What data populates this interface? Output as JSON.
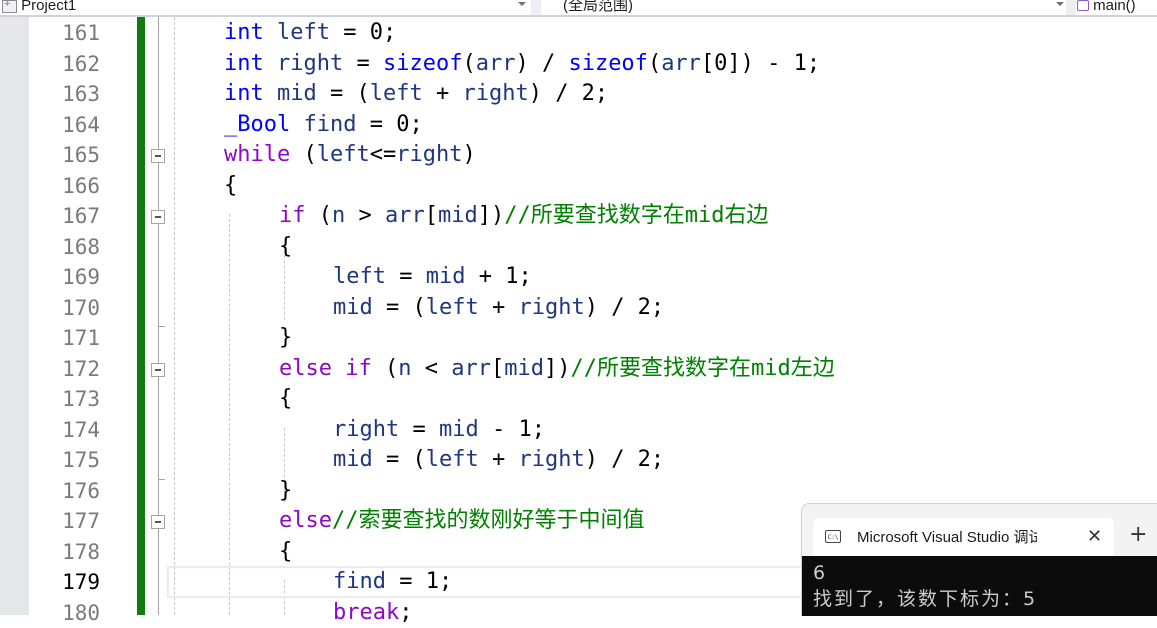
{
  "toolbar": {
    "project": "Project1",
    "scope": "(全局范围)",
    "function": "main()"
  },
  "editor": {
    "current_line": 179,
    "lines": [
      {
        "num": "161",
        "indent": 1,
        "tokens": [
          [
            "kw",
            "int"
          ],
          [
            "pn",
            " "
          ],
          [
            "var",
            "left"
          ],
          [
            "pn",
            " = 0;"
          ]
        ]
      },
      {
        "num": "162",
        "indent": 1,
        "tokens": [
          [
            "kw",
            "int"
          ],
          [
            "pn",
            " "
          ],
          [
            "var",
            "right"
          ],
          [
            "pn",
            " = "
          ],
          [
            "kw",
            "sizeof"
          ],
          [
            "pn",
            "("
          ],
          [
            "var",
            "arr"
          ],
          [
            "pn",
            ") / "
          ],
          [
            "kw",
            "sizeof"
          ],
          [
            "pn",
            "("
          ],
          [
            "var",
            "arr"
          ],
          [
            "pn",
            "[0]) - 1;"
          ]
        ]
      },
      {
        "num": "163",
        "indent": 1,
        "tokens": [
          [
            "kw",
            "int"
          ],
          [
            "pn",
            " "
          ],
          [
            "var",
            "mid"
          ],
          [
            "pn",
            " = ("
          ],
          [
            "var",
            "left"
          ],
          [
            "pn",
            " + "
          ],
          [
            "var",
            "right"
          ],
          [
            "pn",
            ") / 2;"
          ]
        ]
      },
      {
        "num": "164",
        "indent": 1,
        "tokens": [
          [
            "kw",
            "_Bool"
          ],
          [
            "pn",
            " "
          ],
          [
            "var",
            "find"
          ],
          [
            "pn",
            " = 0;"
          ]
        ]
      },
      {
        "num": "165",
        "indent": 1,
        "fold": true,
        "tokens": [
          [
            "ctl",
            "while"
          ],
          [
            "pn",
            " ("
          ],
          [
            "var",
            "left"
          ],
          [
            "pn",
            "<="
          ],
          [
            "var",
            "right"
          ],
          [
            "pn",
            ")"
          ]
        ]
      },
      {
        "num": "166",
        "indent": 1,
        "tokens": [
          [
            "pn",
            "{"
          ]
        ]
      },
      {
        "num": "167",
        "indent": 2,
        "fold": true,
        "tokens": [
          [
            "ctl",
            "if"
          ],
          [
            "pn",
            " ("
          ],
          [
            "var",
            "n"
          ],
          [
            "pn",
            " > "
          ],
          [
            "var",
            "arr"
          ],
          [
            "pn",
            "["
          ],
          [
            "var",
            "mid"
          ],
          [
            "pn",
            "])"
          ],
          [
            "cm",
            "//所要查找数字在mid右边"
          ]
        ]
      },
      {
        "num": "168",
        "indent": 2,
        "tokens": [
          [
            "pn",
            "{"
          ]
        ]
      },
      {
        "num": "169",
        "indent": 3,
        "tokens": [
          [
            "var",
            "left"
          ],
          [
            "pn",
            " = "
          ],
          [
            "var",
            "mid"
          ],
          [
            "pn",
            " + 1;"
          ]
        ]
      },
      {
        "num": "170",
        "indent": 3,
        "tokens": [
          [
            "var",
            "mid"
          ],
          [
            "pn",
            " = ("
          ],
          [
            "var",
            "left"
          ],
          [
            "pn",
            " + "
          ],
          [
            "var",
            "right"
          ],
          [
            "pn",
            ") / 2;"
          ]
        ]
      },
      {
        "num": "171",
        "indent": 2,
        "tokens": [
          [
            "pn",
            "}"
          ]
        ]
      },
      {
        "num": "172",
        "indent": 2,
        "fold": true,
        "tokens": [
          [
            "ctl",
            "else"
          ],
          [
            "pn",
            " "
          ],
          [
            "ctl",
            "if"
          ],
          [
            "pn",
            " ("
          ],
          [
            "var",
            "n"
          ],
          [
            "pn",
            " < "
          ],
          [
            "var",
            "arr"
          ],
          [
            "pn",
            "["
          ],
          [
            "var",
            "mid"
          ],
          [
            "pn",
            "])"
          ],
          [
            "cm",
            "//所要查找数字在mid左边"
          ]
        ]
      },
      {
        "num": "173",
        "indent": 2,
        "tokens": [
          [
            "pn",
            "{"
          ]
        ]
      },
      {
        "num": "174",
        "indent": 3,
        "tokens": [
          [
            "var",
            "right"
          ],
          [
            "pn",
            " = "
          ],
          [
            "var",
            "mid"
          ],
          [
            "pn",
            " - 1;"
          ]
        ]
      },
      {
        "num": "175",
        "indent": 3,
        "tokens": [
          [
            "var",
            "mid"
          ],
          [
            "pn",
            " = ("
          ],
          [
            "var",
            "left"
          ],
          [
            "pn",
            " + "
          ],
          [
            "var",
            "right"
          ],
          [
            "pn",
            ") / 2;"
          ]
        ]
      },
      {
        "num": "176",
        "indent": 2,
        "tokens": [
          [
            "pn",
            "}"
          ]
        ]
      },
      {
        "num": "177",
        "indent": 2,
        "fold": true,
        "tokens": [
          [
            "ctl",
            "else"
          ],
          [
            "cm",
            "//索要查找的数刚好等于中间值"
          ]
        ]
      },
      {
        "num": "178",
        "indent": 2,
        "tokens": [
          [
            "pn",
            "{"
          ]
        ]
      },
      {
        "num": "179",
        "indent": 3,
        "tokens": [
          [
            "var",
            "find"
          ],
          [
            "pn",
            " = 1;"
          ]
        ]
      },
      {
        "num": "180",
        "indent": 3,
        "tokens": [
          [
            "ctl",
            "break"
          ],
          [
            "pn",
            ";"
          ]
        ]
      }
    ]
  },
  "console": {
    "tab_title": "Microsoft Visual Studio 调试控制台",
    "icon": "terminal-icon",
    "icon_text": "C:\\",
    "close_symbol": "✕",
    "add_symbol": "+",
    "output": [
      "6",
      "找到了，该数下标为：5"
    ]
  },
  "colors": {
    "keyword": "#0000ff",
    "control": "#8f08c4",
    "variable": "#1f377f",
    "comment": "#008000",
    "change_bar": "#107c10",
    "console_bg": "#0c0c0c"
  }
}
